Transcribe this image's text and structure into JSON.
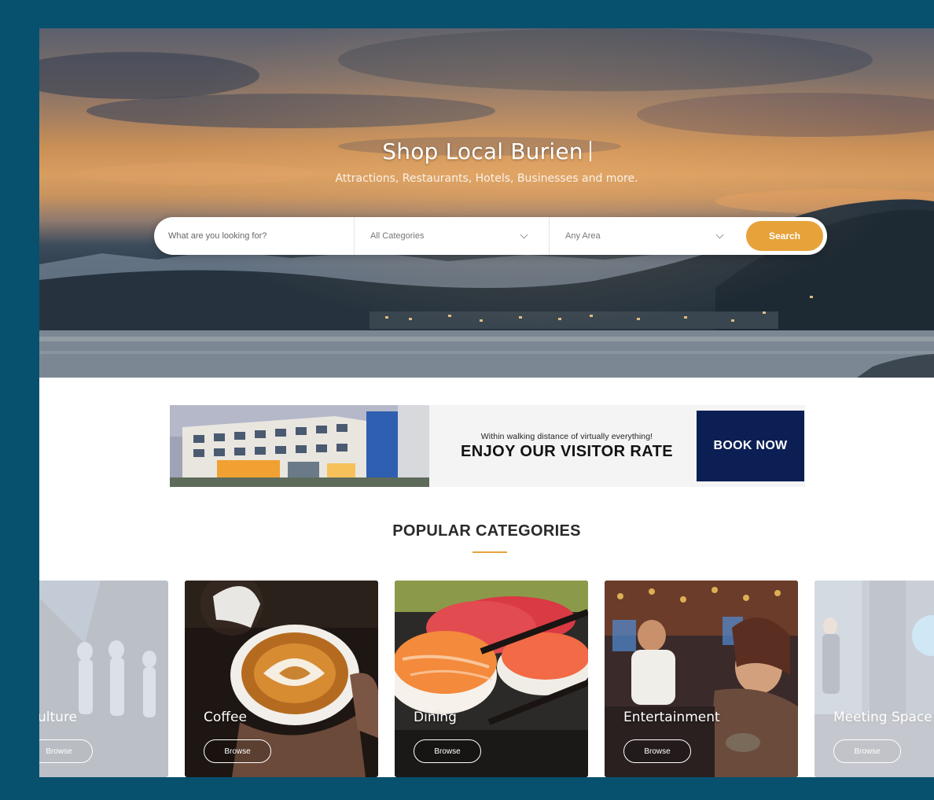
{
  "hero": {
    "title": "Shop Local Burien",
    "subtitle": "Attractions, Restaurants, Hotels, Businesses and more."
  },
  "search": {
    "placeholder": "What are you looking for?",
    "category_value": "All Categories",
    "area_value": "Any Area",
    "button_label": "Search"
  },
  "ad": {
    "tagline": "Within walking distance of virtually everything!",
    "headline": "ENJOY OUR VISITOR RATE",
    "cta": "BOOK NOW"
  },
  "categories": {
    "heading": "POPULAR CATEGORIES",
    "items": [
      {
        "label": "ulture",
        "button": "Browse"
      },
      {
        "label": "Coffee",
        "button": "Browse"
      },
      {
        "label": "Dining",
        "button": "Browse"
      },
      {
        "label": "Entertainment",
        "button": "Browse"
      },
      {
        "label": "Meeting Space",
        "button": "Browse"
      }
    ]
  },
  "colors": {
    "frame_border": "#07506e",
    "accent": "#e7a23a",
    "book_now_bg": "#0b1f55"
  }
}
